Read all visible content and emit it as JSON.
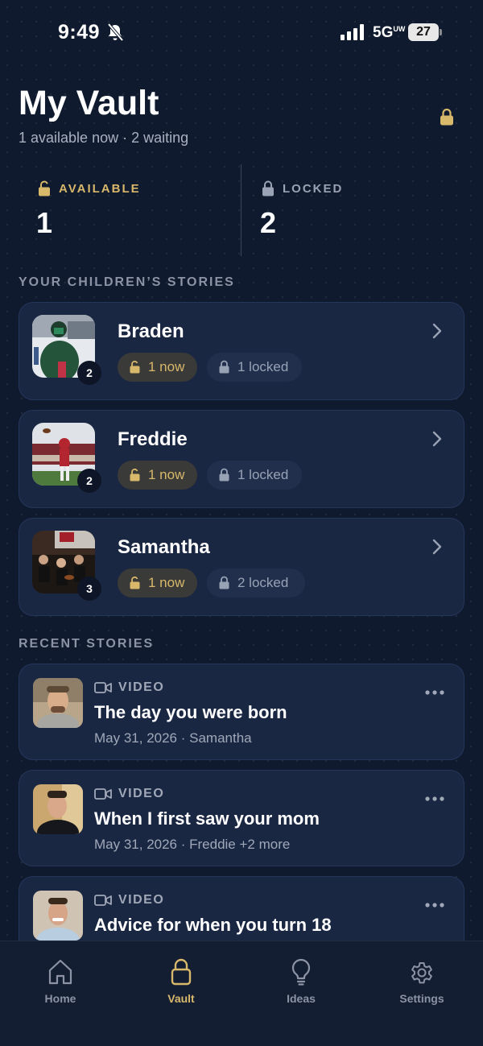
{
  "status_bar": {
    "time": "9:49",
    "network": "5G",
    "network_sup": "UW",
    "battery": "27"
  },
  "header": {
    "title": "My Vault",
    "subtitle": "1 available now · 2 waiting"
  },
  "stats": {
    "available": {
      "label": "AVAILABLE",
      "value": "1"
    },
    "locked": {
      "label": "LOCKED",
      "value": "2"
    }
  },
  "children_section": {
    "label": "YOUR CHILDREN’S STORIES"
  },
  "children": [
    {
      "name": "Braden",
      "count": "2",
      "now_label": "1 now",
      "locked_label": "1 locked"
    },
    {
      "name": "Freddie",
      "count": "2",
      "now_label": "1 now",
      "locked_label": "1 locked"
    },
    {
      "name": "Samantha",
      "count": "3",
      "now_label": "1 now",
      "locked_label": "2 locked"
    }
  ],
  "recent_section": {
    "label": "RECENT STORIES"
  },
  "stories": [
    {
      "type": "VIDEO",
      "title": "The day you were born",
      "meta": "May 31, 2026 · Samantha"
    },
    {
      "type": "VIDEO",
      "title": "When I first saw your mom",
      "meta": "May 31, 2026 · Freddie +2 more"
    },
    {
      "type": "VIDEO",
      "title": "Advice for when you turn 18",
      "meta": ""
    }
  ],
  "tabs": [
    {
      "label": "Home",
      "icon": "home-icon"
    },
    {
      "label": "Vault",
      "icon": "lock-icon"
    },
    {
      "label": "Ideas",
      "icon": "lightbulb-icon"
    },
    {
      "label": "Settings",
      "icon": "gear-icon"
    }
  ],
  "colors": {
    "background": "#0f1a2e",
    "card": "#1a2743",
    "accent_gold": "#d8b86a",
    "muted": "#8b93a5"
  }
}
